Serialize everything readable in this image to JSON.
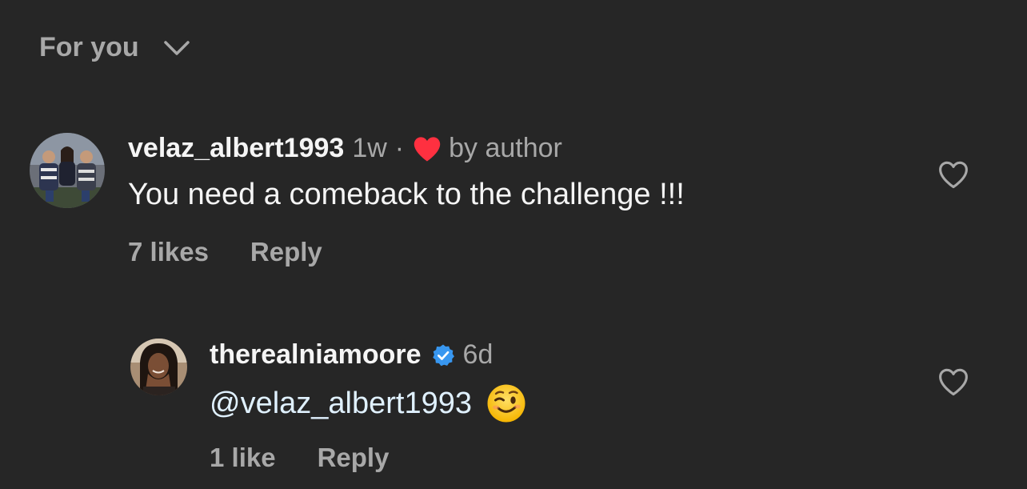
{
  "sort": {
    "label": "For you",
    "icon": "chevron-down-icon"
  },
  "comments": [
    {
      "username": "velaz_albert1993",
      "time": "1w",
      "separator": "·",
      "author_like_icon": "heart-filled-icon",
      "author_like_label": "by author",
      "text": "You need a comeback to the challenge !!!",
      "likes": "7 likes",
      "reply": "Reply",
      "like_icon": "heart-outline-icon"
    },
    {
      "username": "therealniamoore",
      "verified_icon": "verified-badge-icon",
      "time": "6d",
      "mention": "@velaz_albert1993",
      "emoji_icon": "winking-face-emoji",
      "likes": "1 like",
      "reply": "Reply",
      "like_icon": "heart-outline-icon"
    }
  ],
  "colors": {
    "background": "#262626",
    "primary_text": "#f5f5f5",
    "secondary_text": "#a8a8a8",
    "heart_red": "#ff3040",
    "verified_blue": "#3897f0"
  }
}
